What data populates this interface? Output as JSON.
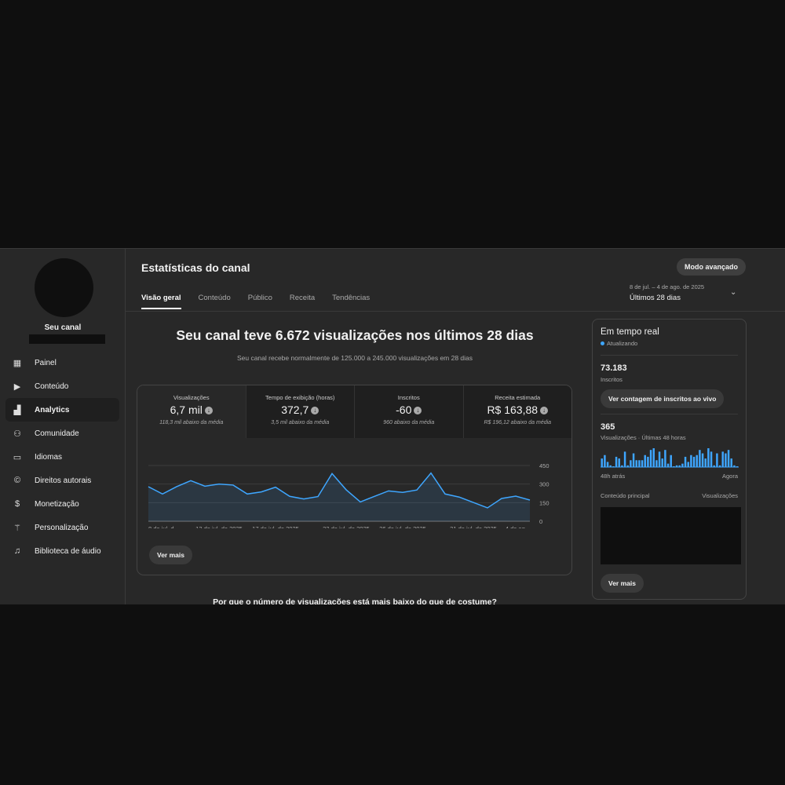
{
  "sidebar": {
    "channel_name": "Seu canal",
    "items": [
      {
        "label": "Painel",
        "icon": "dashboard-icon",
        "glyph": "▦"
      },
      {
        "label": "Conteúdo",
        "icon": "content-icon",
        "glyph": "▶"
      },
      {
        "label": "Analytics",
        "icon": "analytics-icon",
        "glyph": "▟"
      },
      {
        "label": "Comunidade",
        "icon": "community-icon",
        "glyph": "⚇"
      },
      {
        "label": "Idiomas",
        "icon": "subtitles-icon",
        "glyph": "▭"
      },
      {
        "label": "Direitos autorais",
        "icon": "copyright-icon",
        "glyph": "©"
      },
      {
        "label": "Monetização",
        "icon": "dollar-icon",
        "glyph": "$"
      },
      {
        "label": "Personalização",
        "icon": "magic-wand-icon",
        "glyph": "⚚"
      },
      {
        "label": "Biblioteca de áudio",
        "icon": "audio-library-icon",
        "glyph": "♫"
      }
    ]
  },
  "header": {
    "title": "Estatísticas do canal",
    "advanced_button": "Modo avançado",
    "date_range": "8 de jul. – 4 de ago. de 2025",
    "period": "Últimos 28 dias",
    "tabs": [
      "Visão geral",
      "Conteúdo",
      "Público",
      "Receita",
      "Tendências"
    ]
  },
  "main": {
    "headline": "Seu canal teve 6.672 visualizações nos últimos 28 dias",
    "subline": "Seu canal recebe normalmente de 125.000 a 245.000 visualizações em 28 dias",
    "metrics": [
      {
        "label": "Visualizações",
        "value": "6,7 mil",
        "note": "118,3 mil abaixo da média"
      },
      {
        "label": "Tempo de exibição (horas)",
        "value": "372,7",
        "note": "3,5 mil abaixo da média"
      },
      {
        "label": "Inscritos",
        "value": "-60",
        "note": "960 abaixo da média"
      },
      {
        "label": "Receita estimada",
        "value": "R$ 163,88",
        "note": "R$ 196,12 abaixo da média"
      }
    ],
    "see_more": "Ver mais",
    "question": "Por que o número de visualizações está mais baixo do que de costume?"
  },
  "chart_data": {
    "type": "area",
    "title": "Visualizações",
    "ylim": [
      0,
      450
    ],
    "yticks": [
      "0",
      "150",
      "300",
      "450"
    ],
    "xtick_labels": [
      "8 de jul. d...",
      "13 de jul. de 2025",
      "17 de jul. de 2025",
      "22 de jul. de 2025",
      "26 de jul. de 2025",
      "31 de jul. de 2025",
      "4 de ag..."
    ],
    "xtick_index": [
      0,
      5,
      9,
      14,
      18,
      23,
      27
    ],
    "values": [
      279,
      220,
      279,
      328,
      283,
      300,
      292,
      220,
      237,
      275,
      201,
      180,
      199,
      385,
      254,
      156,
      201,
      245,
      233,
      252,
      389,
      220,
      195,
      152,
      108,
      184,
      203,
      171
    ],
    "color": "#3ea6ff"
  },
  "realtime": {
    "title": "Em tempo real",
    "status": "Atualizando",
    "subscribers": "73.183",
    "subscribers_label": "Inscritos",
    "live_button": "Ver contagem de inscritos ao vivo",
    "views": "365",
    "views_label": "Visualizações · Últimas 48 horas",
    "start_label": "48h atrás",
    "end_label": "Agora",
    "content_label": "Conteúdo principal",
    "content_views_label": "Visualizações",
    "see_more": "Ver mais",
    "hourly_views": [
      5,
      7,
      3,
      1,
      0,
      6,
      5,
      1,
      9,
      1,
      4,
      8,
      4,
      4,
      4,
      7,
      6,
      10,
      11,
      4,
      9,
      5,
      10,
      2,
      7,
      0,
      1,
      1,
      2,
      6,
      3,
      7,
      6,
      7,
      10,
      8,
      5,
      11,
      9,
      1,
      8,
      1,
      9,
      8,
      10,
      5,
      1,
      0
    ]
  }
}
